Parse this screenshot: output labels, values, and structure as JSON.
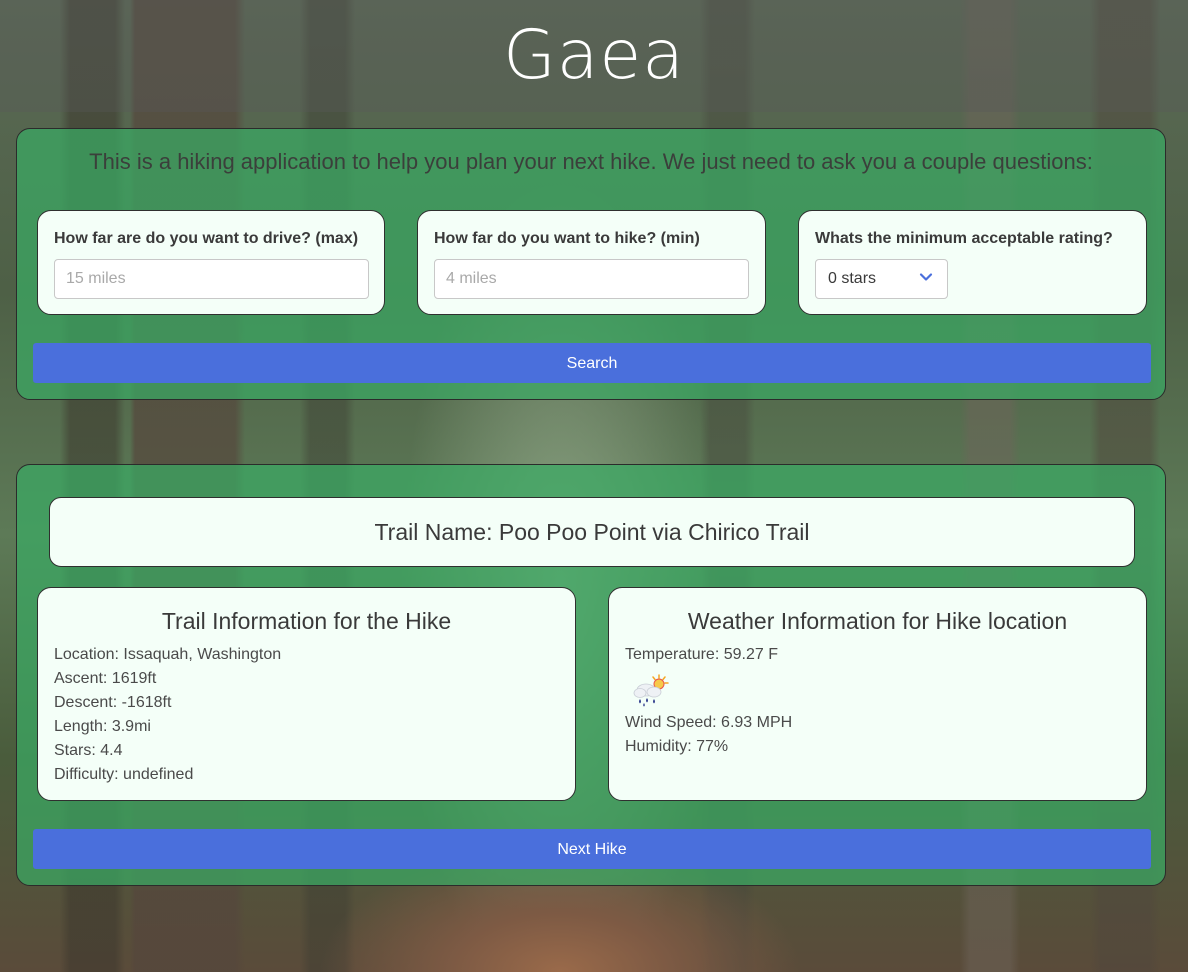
{
  "app": {
    "title": "Gaea"
  },
  "search_panel": {
    "intro": "This is a hiking application to help you plan your next hike. We just need to ask you a couple questions:",
    "questions": [
      {
        "label": "How far are do you want to drive? (max)",
        "placeholder": "15 miles",
        "value": ""
      },
      {
        "label": "How far do you want to hike? (min)",
        "placeholder": "4 miles",
        "value": ""
      },
      {
        "label": "Whats the minimum acceptable rating?",
        "selected": "0 stars"
      }
    ],
    "search_button": "Search"
  },
  "results_panel": {
    "trail_name": "Trail Name: Poo Poo Point via Chirico Trail",
    "trail_info": {
      "title": "Trail Information for the Hike",
      "location": "Location: Issaquah, Washington",
      "ascent": "Ascent: 1619ft",
      "descent": "Descent: -1618ft",
      "length": "Length: 3.9mi",
      "stars": "Stars: 4.4",
      "difficulty": "Difficulty: undefined"
    },
    "weather_info": {
      "title": "Weather Information for Hike location",
      "temperature": "Temperature: 59.27 F",
      "icon": "rain-sun-icon",
      "wind_speed": "Wind Speed: 6.93 MPH",
      "humidity": "Humidity: 77%"
    },
    "next_button": "Next Hike"
  },
  "colors": {
    "panel_green": "#3aaa64",
    "button_blue": "#4a6fdc",
    "card_background": "#f4fff8"
  }
}
